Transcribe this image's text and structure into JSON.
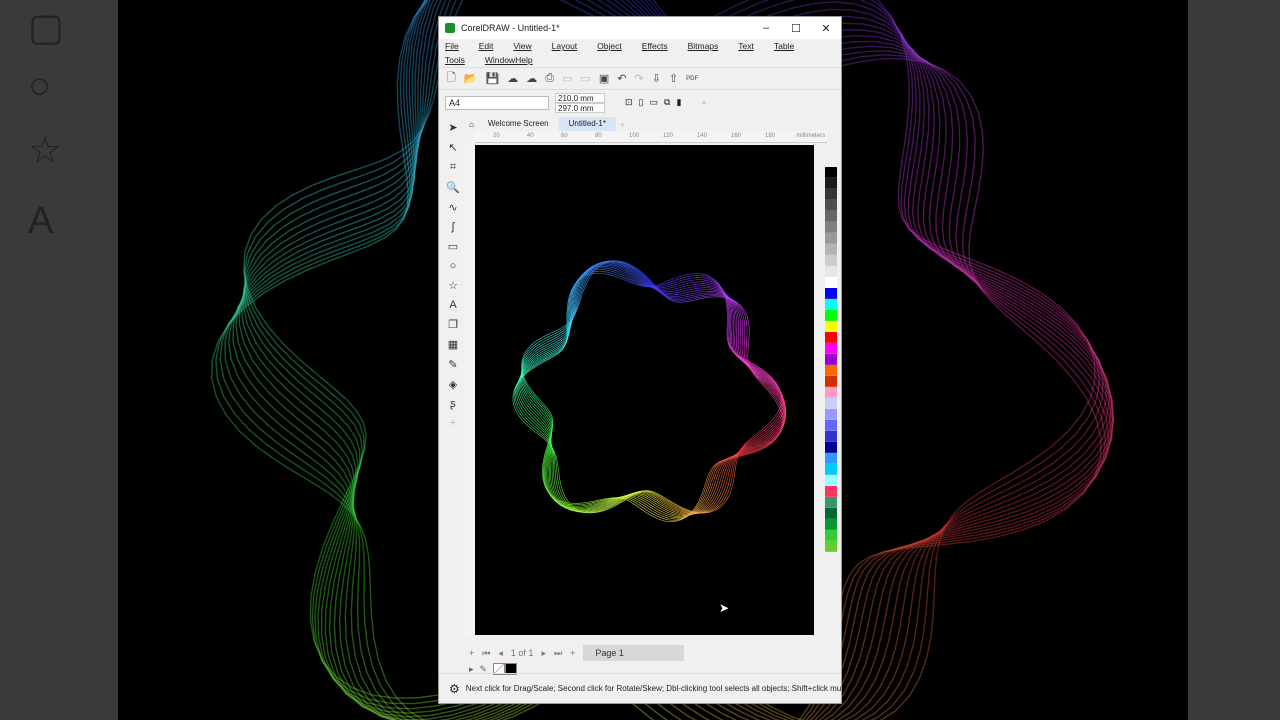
{
  "window": {
    "title": "CorelDRAW - Untitled-1*"
  },
  "menu": [
    "File",
    "Edit",
    "View",
    "Layout",
    "Object",
    "Effects",
    "Bitmaps",
    "Text",
    "Table",
    "Tools",
    "Window",
    "Help"
  ],
  "property_bar": {
    "page_size": "A4",
    "width": "210.0 mm",
    "height": "297.0 mm"
  },
  "tabs": [
    "Welcome Screen",
    "Untitled-1*"
  ],
  "ruler": {
    "ticks": [
      "20",
      "40",
      "60",
      "80",
      "100",
      "120",
      "140",
      "160",
      "180"
    ],
    "unit": "millimeters"
  },
  "pager": {
    "position": "1 of 1",
    "page_tab": "Page 1"
  },
  "status": {
    "hint": "Next click for Drag/Scale; Second click for Rotate/Skew; Dbl-clicking tool selects all objects; Shift+click mu"
  },
  "palette": [
    "#000000",
    "#1a1a1a",
    "#333333",
    "#4d4d4d",
    "#666666",
    "#808080",
    "#999999",
    "#b3b3b3",
    "#cccccc",
    "#e6e6e6",
    "#ffffff",
    "#0000ff",
    "#00ffff",
    "#00ff00",
    "#ffff00",
    "#ff0000",
    "#ff00ff",
    "#9900cc",
    "#ff6600",
    "#cc3300",
    "#ff99cc",
    "#ccccff",
    "#9999ff",
    "#6666ff",
    "#3333cc",
    "#000099",
    "#3399ff",
    "#00ccff",
    "#99ffff",
    "#ff3366",
    "#339966",
    "#006633",
    "#009933",
    "#33cc33",
    "#66cc33"
  ]
}
